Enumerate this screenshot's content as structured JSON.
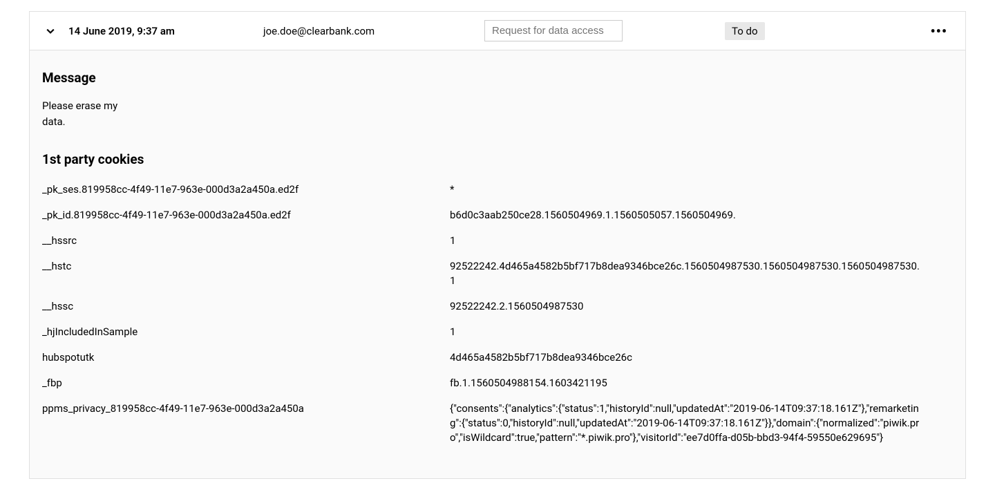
{
  "header": {
    "date": "14 June 2019, 9:37 am",
    "email": "joe.doe@clearbank.com",
    "request_placeholder": "Request for data access",
    "status": "To do"
  },
  "message": {
    "heading": "Message",
    "body": "Please erase my data."
  },
  "cookies": {
    "heading": "1st party cookies",
    "rows": [
      {
        "name": "_pk_ses.819958cc-4f49-11e7-963e-000d3a2a450a.ed2f",
        "value": "*"
      },
      {
        "name": "_pk_id.819958cc-4f49-11e7-963e-000d3a2a450a.ed2f",
        "value": "b6d0c3aab250ce28.1560504969.1.1560505057.1560504969."
      },
      {
        "name": "__hssrc",
        "value": "1"
      },
      {
        "name": "__hstc",
        "value": "92522242.4d465a4582b5bf717b8dea9346bce26c.1560504987530.1560504987530.1560504987530.1"
      },
      {
        "name": "__hssc",
        "value": "92522242.2.1560504987530"
      },
      {
        "name": "_hjIncludedInSample",
        "value": "1"
      },
      {
        "name": "hubspotutk",
        "value": "4d465a4582b5bf717b8dea9346bce26c"
      },
      {
        "name": "_fbp",
        "value": "fb.1.1560504988154.1603421195"
      },
      {
        "name": "ppms_privacy_819958cc-4f49-11e7-963e-000d3a2a450a",
        "value": "{\"consents\":{\"analytics\":{\"status\":1,\"historyId\":null,\"updatedAt\":\"2019-06-14T09:37:18.161Z\"},\"remarketing\":{\"status\":0,\"historyId\":null,\"updatedAt\":\"2019-06-14T09:37:18.161Z\"}},\"domain\":{\"normalized\":\"piwik.pro\",\"isWildcard\":true,\"pattern\":\"*.piwik.pro\"},\"visitorId\":\"ee7d0ffa-d05b-bbd3-94f4-59550e629695\"}"
      }
    ]
  }
}
